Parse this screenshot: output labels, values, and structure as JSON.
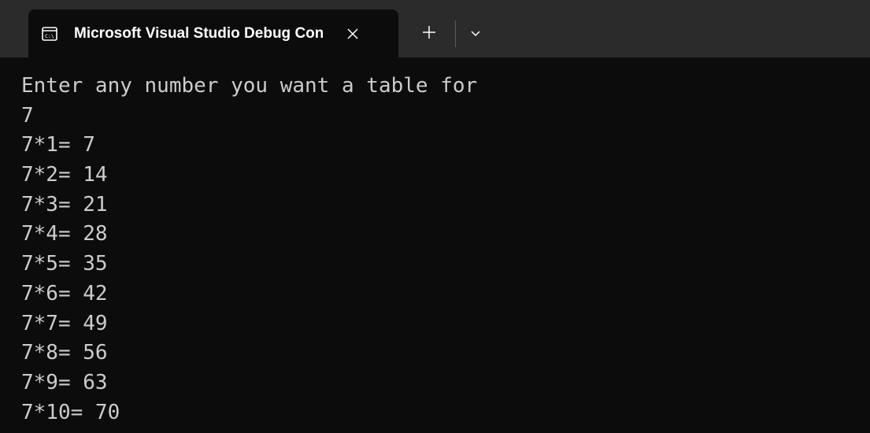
{
  "tab": {
    "title": "Microsoft Visual Studio Debug Console",
    "icon": "console-icon"
  },
  "icons": {
    "close": "close-icon",
    "new_tab": "plus-icon",
    "dropdown": "chevron-down-icon"
  },
  "colors": {
    "titlebar_bg": "#2b2b2b",
    "console_bg": "#0c0c0c",
    "console_text": "#cccccc",
    "tab_text": "#ffffff"
  },
  "console": {
    "lines": [
      "Enter any number you want a table for",
      "7",
      "7*1= 7",
      "7*2= 14",
      "7*3= 21",
      "7*4= 28",
      "7*5= 35",
      "7*6= 42",
      "7*7= 49",
      "7*8= 56",
      "7*9= 63",
      "7*10= 70"
    ]
  }
}
